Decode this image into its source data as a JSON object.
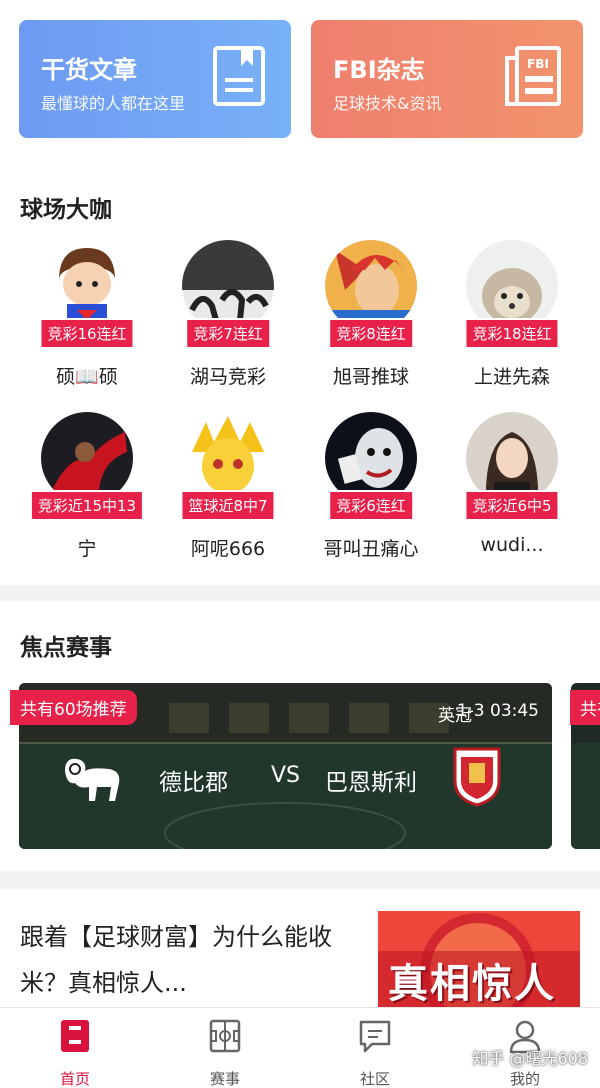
{
  "top_cards": [
    {
      "title": "干货文章",
      "subtitle": "最懂球的人都在这里",
      "icon": "document-icon"
    },
    {
      "title": "FBI杂志",
      "subtitle": "足球技术&资讯",
      "icon": "fbi-magazine-icon",
      "icon_text": "FBI"
    }
  ],
  "experts_section": {
    "title": "球场大咖",
    "experts": [
      {
        "badge": "竞彩16连红",
        "name": "硕📖硕"
      },
      {
        "badge": "竞彩7连红",
        "name": "湖马竞彩"
      },
      {
        "badge": "竞彩8连红",
        "name": "旭哥推球"
      },
      {
        "badge": "竞彩18连红",
        "name": "上进先森"
      },
      {
        "badge": "竞彩近15中13",
        "name": "宁"
      },
      {
        "badge": "篮球近8中7",
        "name": "阿呢666"
      },
      {
        "badge": "竞彩6连红",
        "name": "哥叫丑痛心"
      },
      {
        "badge": "竞彩近6中5",
        "name": "wudi..."
      }
    ]
  },
  "focus_section": {
    "title": "焦点赛事",
    "match": {
      "badge": "共有60场推荐",
      "league": "英冠",
      "datetime": "1-3 03:45",
      "home": "德比郡",
      "vs": "VS",
      "away": "巴恩斯利"
    },
    "next_badge": "共有"
  },
  "article": {
    "title": "跟着【足球财富】为什么能收米？真相惊人...",
    "image_text": "真相惊人"
  },
  "bottom_nav": [
    {
      "label": "首页",
      "icon": "home-icon",
      "active": true
    },
    {
      "label": "赛事",
      "icon": "pitch-icon",
      "active": false
    },
    {
      "label": "社区",
      "icon": "chat-icon",
      "active": false
    },
    {
      "label": "我的",
      "icon": "user-icon",
      "active": false
    }
  ],
  "watermark": "知乎 @曙光608",
  "colors": {
    "accent": "#e8214a",
    "nav_active": "#d9123d",
    "card_blue": "#6d9af2",
    "card_orange": "#ef7f6e"
  }
}
